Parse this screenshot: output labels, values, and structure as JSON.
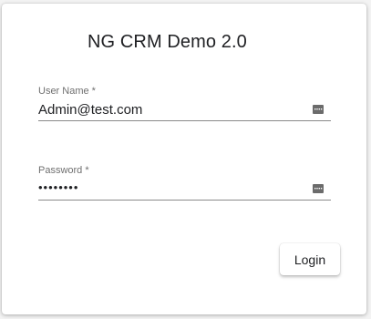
{
  "title": "NG CRM Demo 2.0",
  "username_field": {
    "label": "User Name *",
    "value": "Admin@test.com",
    "icon": "keyboard-icon"
  },
  "password_field": {
    "label": "Password *",
    "value": "••••••••",
    "icon": "keyboard-icon"
  },
  "login_button": {
    "label": "Login"
  }
}
